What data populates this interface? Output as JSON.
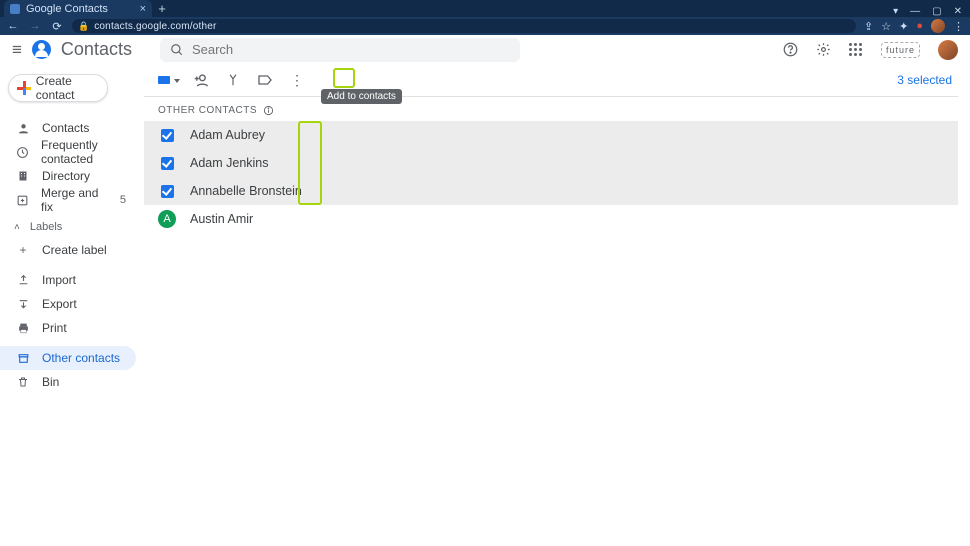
{
  "browser": {
    "tab_title": "Google Contacts",
    "url": "contacts.google.com/other"
  },
  "app": {
    "name": "Contacts",
    "search_placeholder": "Search",
    "future_chip": "future"
  },
  "create_button": "Create contact",
  "sidebar": {
    "nav": [
      {
        "label": "Contacts"
      },
      {
        "label": "Frequently contacted"
      },
      {
        "label": "Directory"
      },
      {
        "label": "Merge and fix",
        "badge": "5"
      }
    ],
    "labels_header": "Labels",
    "create_label": "Create label",
    "io": [
      {
        "label": "Import"
      },
      {
        "label": "Export"
      },
      {
        "label": "Print"
      }
    ],
    "other_contacts": "Other contacts",
    "bin": "Bin"
  },
  "toolbar": {
    "tooltip": "Add to contacts",
    "selected_count": "3 selected"
  },
  "list": {
    "header": "OTHER CONTACTS",
    "rows": [
      {
        "name": "Adam Aubrey",
        "selected": true
      },
      {
        "name": "Adam Jenkins",
        "selected": true
      },
      {
        "name": "Annabelle Bronstein",
        "selected": true
      },
      {
        "name": "Austin Amir",
        "selected": false,
        "initial": "A"
      }
    ]
  }
}
